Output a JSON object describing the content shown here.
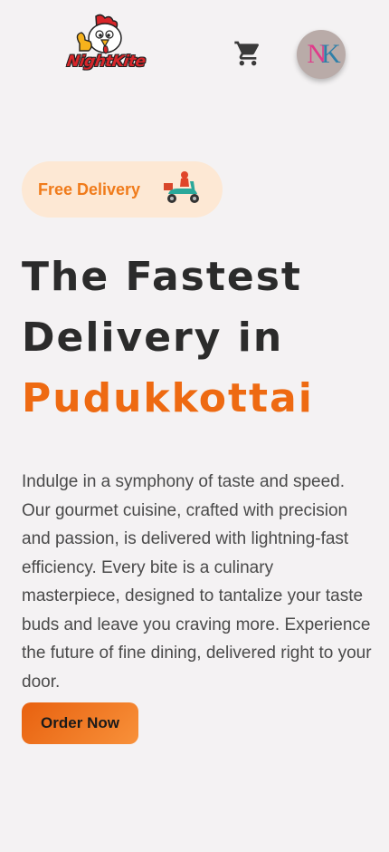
{
  "header": {
    "logo_text": "NightKite",
    "avatar_initials": {
      "first": "N",
      "second": "K"
    },
    "icons": {
      "cart": "cart-icon"
    }
  },
  "hero": {
    "badge_label": "Free Delivery",
    "badge_icon": "delivery-scooter-icon",
    "headline_line1": "The Fastest",
    "headline_line2": "Delivery in",
    "headline_accent": "Pudukkottai",
    "description": "Indulge in a symphony of taste and speed. Our gourmet cuisine, crafted with precision and passion, is delivered with lightning-fast efficiency. Every bite is a culinary masterpiece, designed to tantalize your taste buds and leave you craving more. Experience the future of fine dining, delivered right to your door.",
    "cta_label": "Order Now"
  },
  "colors": {
    "background": "#f4f2f3",
    "accent": "#ee6a12",
    "badge_background": "#fde8d4",
    "text_dark": "#2b2b2b"
  }
}
